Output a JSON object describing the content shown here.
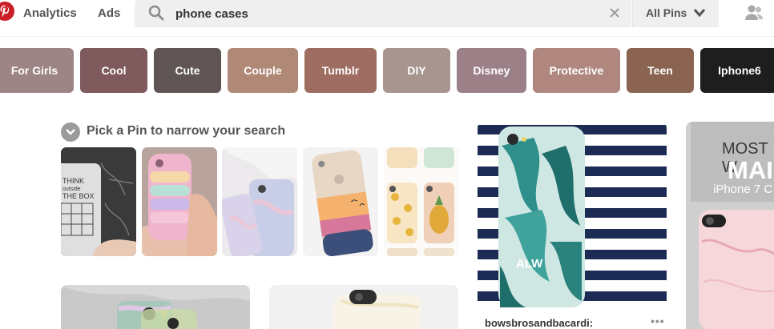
{
  "nav": {
    "analytics": "Analytics",
    "ads": "Ads"
  },
  "search": {
    "query": "phone cases",
    "scope": "All Pins",
    "placeholder": "Search"
  },
  "guides": [
    {
      "label": "For Girls",
      "color": "#9c8584"
    },
    {
      "label": "Cool",
      "color": "#7e5a5d"
    },
    {
      "label": "Cute",
      "color": "#5e5554"
    },
    {
      "label": "Couple",
      "color": "#b08876"
    },
    {
      "label": "Tumblr",
      "color": "#9e6c61"
    },
    {
      "label": "DIY",
      "color": "#a89590"
    },
    {
      "label": "Disney",
      "color": "#9c8088"
    },
    {
      "label": "Protective",
      "color": "#b0877f"
    },
    {
      "label": "Teen",
      "color": "#8a6450"
    },
    {
      "label": "Iphone6",
      "color": "#1e1e1e"
    }
  ],
  "pick": {
    "title": "Pick a Pin to narrow your search"
  },
  "pins": {
    "owner": "bowsbrosandbacardi:",
    "more": "•••",
    "initials": "ALW",
    "promo_line1": "MOST W",
    "promo_line2": "MAI",
    "promo_line3": "iPhone 7 C"
  },
  "thumb_text": {
    "line1": "THINK",
    "line2": "outside",
    "line3": "THE BOX"
  },
  "colors": {
    "brand_red": "#cb1f27",
    "search_bg": "#efefef"
  }
}
